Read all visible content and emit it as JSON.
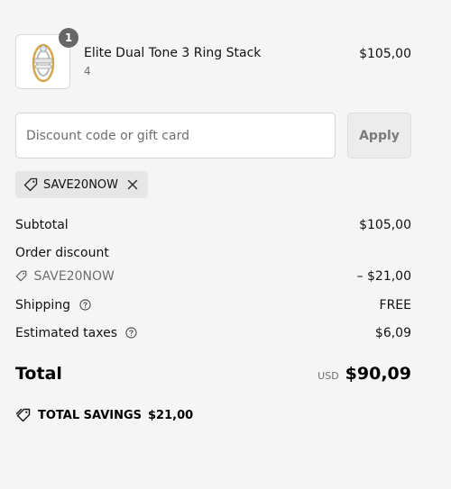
{
  "product": {
    "name": "Elite Dual Tone 3 Ring Stack",
    "variant": "4",
    "quantity": "1",
    "price": "$105,00"
  },
  "discount": {
    "placeholder": "Discount code or gift card",
    "apply_label": "Apply",
    "applied_code": "SAVE20NOW"
  },
  "summary": {
    "subtotal_label": "Subtotal",
    "subtotal_value": "$105,00",
    "order_discount_label": "Order discount",
    "discount_code": "SAVE20NOW",
    "discount_value": "– $21,00",
    "shipping_label": "Shipping",
    "shipping_value": "FREE",
    "taxes_label": "Estimated taxes",
    "taxes_value": "$6,09",
    "total_label": "Total",
    "currency": "USD",
    "total_value": "$90,09",
    "savings_label": "TOTAL SAVINGS",
    "savings_value": "$21,00"
  },
  "colors": {
    "background": "#f5f5f5",
    "chip_bg": "#e6e6e6",
    "badge": "#666666",
    "muted_text": "#6e6e6e"
  },
  "icons": {
    "tag": "tag-icon",
    "close": "close-icon",
    "help": "help-circle-icon",
    "savings": "savings-tag-icon"
  }
}
